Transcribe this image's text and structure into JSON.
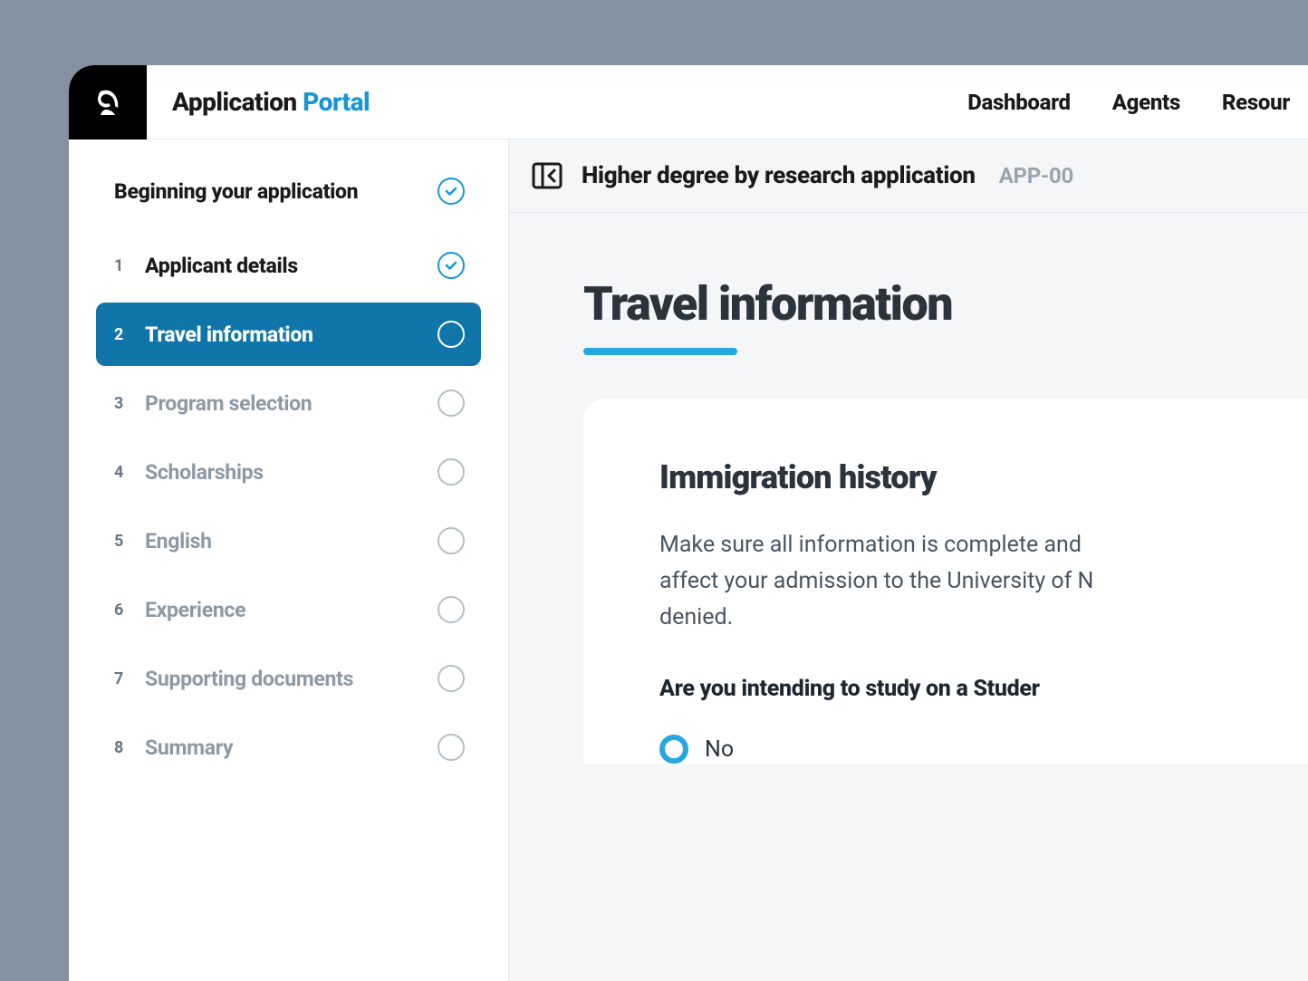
{
  "app_title": {
    "part1": "Application",
    "part2": "Portal"
  },
  "nav": {
    "dashboard": "Dashboard",
    "agents": "Agents",
    "resources": "Resour"
  },
  "sidebar": {
    "header": "Beginning your application",
    "items": [
      {
        "num": "1",
        "label": "Applicant details",
        "status": "completed"
      },
      {
        "num": "2",
        "label": "Travel information",
        "status": "active"
      },
      {
        "num": "3",
        "label": "Program selection",
        "status": "pending"
      },
      {
        "num": "4",
        "label": "Scholarships",
        "status": "pending"
      },
      {
        "num": "5",
        "label": "English",
        "status": "pending"
      },
      {
        "num": "6",
        "label": "Experience",
        "status": "pending"
      },
      {
        "num": "7",
        "label": "Supporting documents",
        "status": "pending"
      },
      {
        "num": "8",
        "label": "Summary",
        "status": "pending"
      }
    ]
  },
  "page": {
    "title": "Higher degree by research application",
    "app_id": "APP-00"
  },
  "section": {
    "title": "Travel information"
  },
  "card": {
    "title": "Immigration history",
    "body_line1": "Make sure all information is complete and ",
    "body_line2": "affect your admission to the University of N",
    "body_line3": "denied.",
    "question": "Are you intending to study on a Studer",
    "option_no": "No"
  }
}
